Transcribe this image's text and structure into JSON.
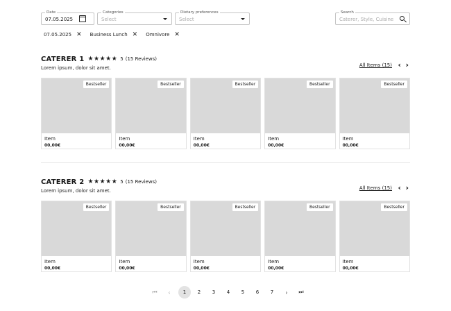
{
  "filters": {
    "date": {
      "label": "Date",
      "value": "07.05.2025"
    },
    "categories": {
      "label": "Categories",
      "placeholder": "Select"
    },
    "dietary": {
      "label": "Dietary preferences",
      "placeholder": "Select"
    },
    "search": {
      "label": "Search",
      "placeholder": "Caterer, Style, Cuisine"
    }
  },
  "chips": [
    "07.05.2025",
    "Business Lunch",
    "Omnivore"
  ],
  "chip_close": "✕",
  "caterers": [
    {
      "name": "CATERER 1",
      "stars": "★★★★★",
      "rating": "5",
      "reviews": "(15 Reviews)",
      "description": "Lorem ipsum, dolor sit amet.",
      "all_items": "All Items (15)",
      "items": [
        {
          "badge": "Bestseller",
          "name": "Item",
          "price": "00,00€"
        },
        {
          "badge": "Bestseller",
          "name": "Item",
          "price": "00,00€"
        },
        {
          "badge": "Bestseller",
          "name": "Item",
          "price": "00,00€"
        },
        {
          "badge": "Bestseller",
          "name": "Item",
          "price": "00,00€"
        },
        {
          "badge": "Bestseller",
          "name": "Item",
          "price": "00,00€"
        }
      ]
    },
    {
      "name": "CATERER 2",
      "stars": "★★★★★",
      "rating": "5",
      "reviews": "(15 Reviews)",
      "description": "Lorem ipsum, dolor sit amet.",
      "all_items": "All Items (15)",
      "items": [
        {
          "badge": "Bestseller",
          "name": "Item",
          "price": "00,00€"
        },
        {
          "badge": "Bestseller",
          "name": "Item",
          "price": "00,00€"
        },
        {
          "badge": "Bestseller",
          "name": "Item",
          "price": "00,00€"
        },
        {
          "badge": "Bestseller",
          "name": "Item",
          "price": "00,00€"
        },
        {
          "badge": "Bestseller",
          "name": "Item",
          "price": "00,00€"
        }
      ]
    }
  ],
  "nav": {
    "prev": "‹",
    "next": "›"
  },
  "pagination": {
    "first": "⏮",
    "prev": "‹",
    "next": "›",
    "last": "⏭",
    "pages": [
      "1",
      "2",
      "3",
      "4",
      "5",
      "6",
      "7"
    ],
    "current": "1"
  }
}
